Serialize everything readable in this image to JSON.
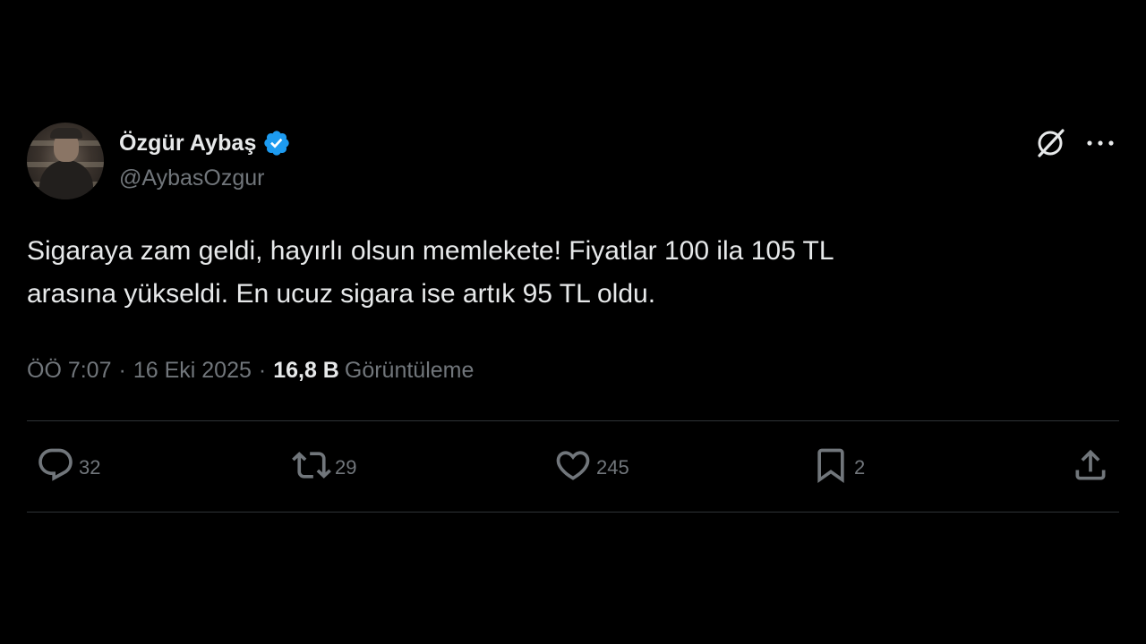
{
  "author": {
    "display_name": "Özgür Aybaş",
    "handle": "@AybasOzgur",
    "verified": true
  },
  "tweet": {
    "text": "Sigaraya zam geldi, hayırlı olsun memlekete! Fiyatlar 100 ila 105 TL\narasına yükseldi. En ucuz sigara ise artık 95 TL oldu."
  },
  "meta": {
    "time": "ÖÖ 7:07",
    "separator": "·",
    "date": "16 Eki 2025",
    "views_count": "16,8 B",
    "views_label": "Görüntüleme"
  },
  "actions": {
    "reply_count": "32",
    "repost_count": "29",
    "like_count": "245",
    "bookmark_count": "2"
  },
  "icons": {
    "verified": "verified-badge-icon",
    "grok": "grok-icon",
    "more": "more-icon",
    "reply": "reply-icon",
    "repost": "repost-icon",
    "like": "heart-icon",
    "bookmark": "bookmark-icon",
    "share": "share-icon"
  },
  "colors": {
    "background": "#000000",
    "text_primary": "#e7e9ea",
    "text_secondary": "#71767b",
    "verified_blue": "#1d9bf0",
    "divider": "#2f3336"
  }
}
